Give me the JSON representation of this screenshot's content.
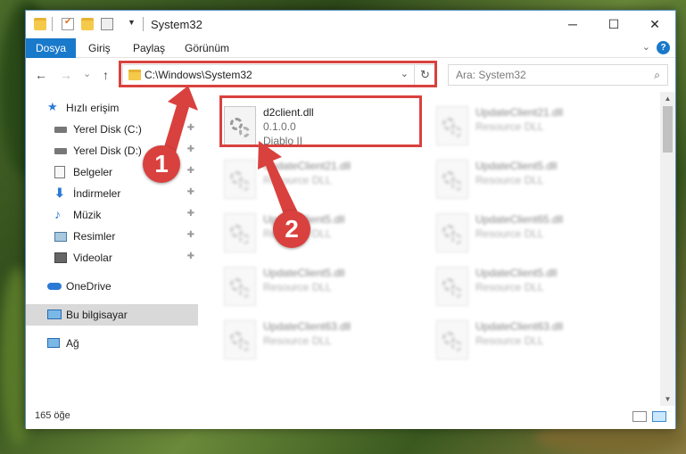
{
  "window": {
    "title": "System32",
    "controls": {
      "minimize": "─",
      "maximize": "☐",
      "close": "✕"
    }
  },
  "ribbon": {
    "tabs": [
      "Dosya",
      "Giriş",
      "Paylaş",
      "Görünüm"
    ],
    "help": "?"
  },
  "nav": {
    "back": "←",
    "forward": "→",
    "recent": "⌄",
    "up": "↑",
    "address": "C:\\Windows\\System32",
    "address_dropdown": "⌄",
    "refresh": "↻",
    "search_placeholder": "Ara: System32",
    "search_icon": "⌕"
  },
  "sidebar": {
    "items": [
      {
        "label": "Hızlı erişim",
        "icon": "star-icon",
        "pinned": false
      },
      {
        "label": "Yerel Disk (C:)",
        "icon": "drive-icon",
        "pinned": true
      },
      {
        "label": "Yerel Disk (D:)",
        "icon": "drive-icon",
        "pinned": true
      },
      {
        "label": "Belgeler",
        "icon": "documents-icon",
        "pinned": true
      },
      {
        "label": "İndirmeler",
        "icon": "downloads-icon",
        "pinned": true
      },
      {
        "label": "Müzik",
        "icon": "music-icon",
        "pinned": true
      },
      {
        "label": "Resimler",
        "icon": "pictures-icon",
        "pinned": true
      },
      {
        "label": "Videolar",
        "icon": "videos-icon",
        "pinned": true
      },
      {
        "label": "OneDrive",
        "icon": "onedrive-icon",
        "pinned": false
      },
      {
        "label": "Bu bilgisayar",
        "icon": "computer-icon",
        "pinned": false
      },
      {
        "label": "Ağ",
        "icon": "network-icon",
        "pinned": false
      }
    ],
    "pin_glyph": "📌"
  },
  "files": [
    {
      "name": "d2client.dll",
      "line2": "0.1.0.0",
      "line3": "Diablo II"
    },
    {
      "name": "UpdateClient21.dll",
      "line2": "Resource DLL",
      "line3": ""
    },
    {
      "name": "UpdateClient21.dll",
      "line2": "Resource DLL",
      "line3": ""
    },
    {
      "name": "UpdateClient5.dll",
      "line2": "Resource DLL",
      "line3": ""
    },
    {
      "name": "UpdateClient5.dll",
      "line2": "Resource DLL",
      "line3": ""
    },
    {
      "name": "UpdateClient65.dll",
      "line2": "Resource DLL",
      "line3": ""
    },
    {
      "name": "UpdateClient5.dll",
      "line2": "Resource DLL",
      "line3": ""
    },
    {
      "name": "UpdateClient5.dll",
      "line2": "Resource DLL",
      "line3": ""
    },
    {
      "name": "UpdateClient63.dll",
      "line2": "Resource DLL",
      "line3": ""
    },
    {
      "name": "UpdateClient63.dll",
      "line2": "Resource DLL",
      "line3": ""
    }
  ],
  "status": {
    "count": "165 öğe"
  },
  "annotations": {
    "step1": "1",
    "step2": "2",
    "color": "#d9413e"
  },
  "colors": {
    "accent": "#1979ca",
    "selection": "#cce8ff"
  }
}
